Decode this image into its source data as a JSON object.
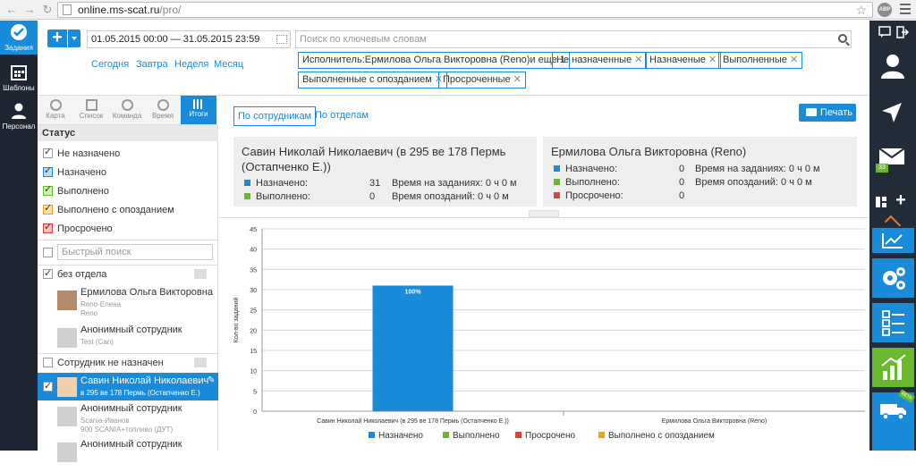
{
  "browser": {
    "url_host": "online.ms-scat.ru",
    "url_path": "/pro/",
    "abp": "ABP"
  },
  "leftbar": {
    "items": [
      {
        "label": "Задания"
      },
      {
        "label": "Шаблоны"
      },
      {
        "label": "Персонал"
      }
    ]
  },
  "toolbar": {
    "add_label": "+",
    "date_range": "01.05.2015 00:00 — 31.05.2015 23:59",
    "quick_ranges": [
      "Сегодня",
      "Завтра",
      "Неделя",
      "Месяц"
    ],
    "search_placeholder": "Поиск по ключевым словам",
    "chips": [
      "Исполнитель:Ермилова Ольга Викторовна (Reno)и еще 1",
      "Не назначенные",
      "Назначеные",
      "Выполненные",
      "Выполненные с опозданием",
      "Просроченные"
    ]
  },
  "subtabs": [
    "Карта",
    "Список",
    "Команда",
    "Время",
    "Итоги"
  ],
  "status": {
    "title": "Статус",
    "items": [
      {
        "label": "Не назначено",
        "color": "#ffffff"
      },
      {
        "label": "Назначено",
        "color": "#1a8bd8"
      },
      {
        "label": "Выполнено",
        "color": "#6ab82e"
      },
      {
        "label": "Выполнено с опозданием",
        "color": "#f0a400"
      },
      {
        "label": "Просрочено",
        "color": "#e0403a"
      }
    ]
  },
  "quick_search_placeholder": "Быстрый поиск",
  "groups": {
    "no_dept": "без отдела",
    "unassigned": "Сотрудник не назначен"
  },
  "people": [
    {
      "name": "Ермилова Ольга Викторовна",
      "sub1": "Reno-Елена",
      "sub2": "Reno"
    },
    {
      "name": "Анонимный сотрудник",
      "sub1": "Test (Can)",
      "sub2": ""
    },
    {
      "name": "Савин Николай Николаевич",
      "sub1": "в 295 ве 178 Пермь (Остапченко Е.)",
      "sub2": ""
    },
    {
      "name": "Анонимный сотрудник",
      "sub1": "Scania-Иванов",
      "sub2": "900 SCANIA+топливо (ДУТ)"
    },
    {
      "name": "Анонимный сотрудник",
      "sub1": "",
      "sub2": ""
    }
  ],
  "main": {
    "tab_employees": "По сотрудникам",
    "tab_departments": "По отделам",
    "print": "Печать",
    "cards": [
      {
        "name": "Савин Николай Николаевич (в 295 ве 178 Пермь (Остапченко Е.))",
        "assigned_label": "Назначено:",
        "assigned": "31",
        "done_label": "Выполнено:",
        "done": "0",
        "time_tasks_label": "Время на заданиях:",
        "time_tasks": "0 ч 0 м",
        "time_late_label": "Время опозданий:",
        "time_late": "0 ч 0 м"
      },
      {
        "name": "Ермилова Ольга Викторовна (Reno)",
        "assigned_label": "Назначено:",
        "assigned": "0",
        "done_label": "Выполнено:",
        "done": "0",
        "overdue_label": "Просрочено:",
        "overdue": "0",
        "time_tasks_label": "Время на заданиях:",
        "time_tasks": "0 ч 0 м",
        "time_late_label": "Время опозданий:",
        "time_late": "0 ч 0 м"
      }
    ]
  },
  "rightbar": {
    "badge": "33",
    "beta": "BETA"
  },
  "chart_data": {
    "type": "bar",
    "categories": [
      "Савин Николай Николаевич (в 295 ве 178 Пермь (Остапченко Е.))",
      "Ермилова Ольга Викторовна (Reno)"
    ],
    "series": [
      {
        "name": "Назначено",
        "color": "#1a8bd8",
        "values": [
          31,
          0
        ]
      },
      {
        "name": "Выполнено",
        "color": "#6ab82e",
        "values": [
          0,
          0
        ]
      },
      {
        "name": "Просрочено",
        "color": "#e0403a",
        "values": [
          0,
          0
        ]
      },
      {
        "name": "Выполнено с опозданием",
        "color": "#f0a400",
        "values": [
          0,
          0
        ]
      }
    ],
    "bar_labels": [
      "100%"
    ],
    "ylabel": "Кол-во заданий",
    "ylim": [
      0,
      45
    ],
    "yticks": [
      0,
      5,
      10,
      15,
      20,
      25,
      30,
      35,
      40,
      45
    ],
    "grid": true,
    "legend": "bottom"
  }
}
